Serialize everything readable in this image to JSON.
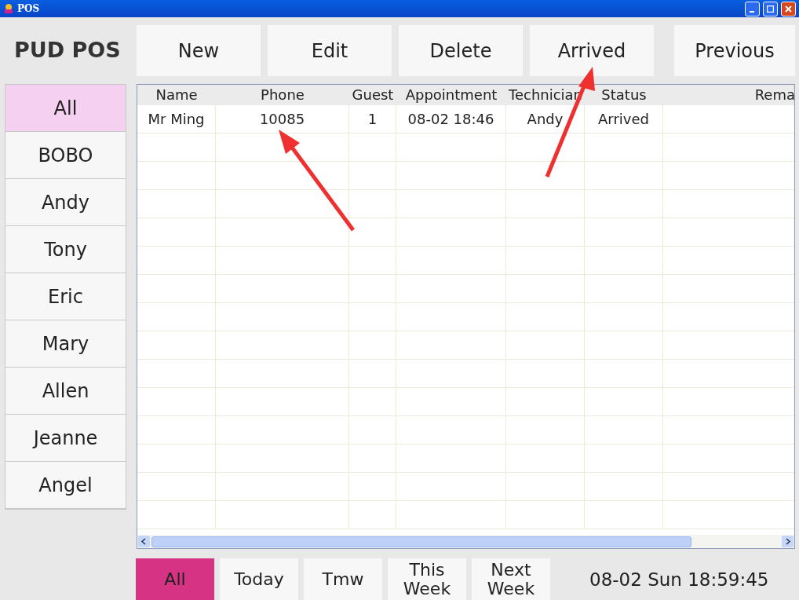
{
  "window": {
    "title": "POS"
  },
  "logo": "PUD POS",
  "toolbar": [
    "New",
    "Edit",
    "Delete",
    "Arrived",
    "Previous"
  ],
  "sidebar": {
    "items": [
      {
        "label": "All",
        "selected": true
      },
      {
        "label": "BOBO",
        "selected": false
      },
      {
        "label": "Andy",
        "selected": false
      },
      {
        "label": "Tony",
        "selected": false
      },
      {
        "label": "Eric",
        "selected": false
      },
      {
        "label": "Mary",
        "selected": false
      },
      {
        "label": "Allen",
        "selected": false
      },
      {
        "label": "Jeanne",
        "selected": false
      },
      {
        "label": "Angel",
        "selected": false
      }
    ]
  },
  "table": {
    "columns": [
      "Name",
      "Phone",
      "Guest",
      "Appointment",
      "Technician",
      "Status",
      "Rema"
    ],
    "rows": [
      [
        "Mr Ming",
        "10085",
        "1",
        "08-02 18:46",
        "Andy",
        "Arrived",
        ""
      ]
    ]
  },
  "filters": [
    {
      "label": "All",
      "selected": true
    },
    {
      "label": "Today",
      "selected": false
    },
    {
      "label": "Tmw",
      "selected": false
    },
    {
      "label": "This Week",
      "selected": false
    },
    {
      "label": "Next Week",
      "selected": false
    }
  ],
  "clock": "08-02 Sun 18:59:45"
}
